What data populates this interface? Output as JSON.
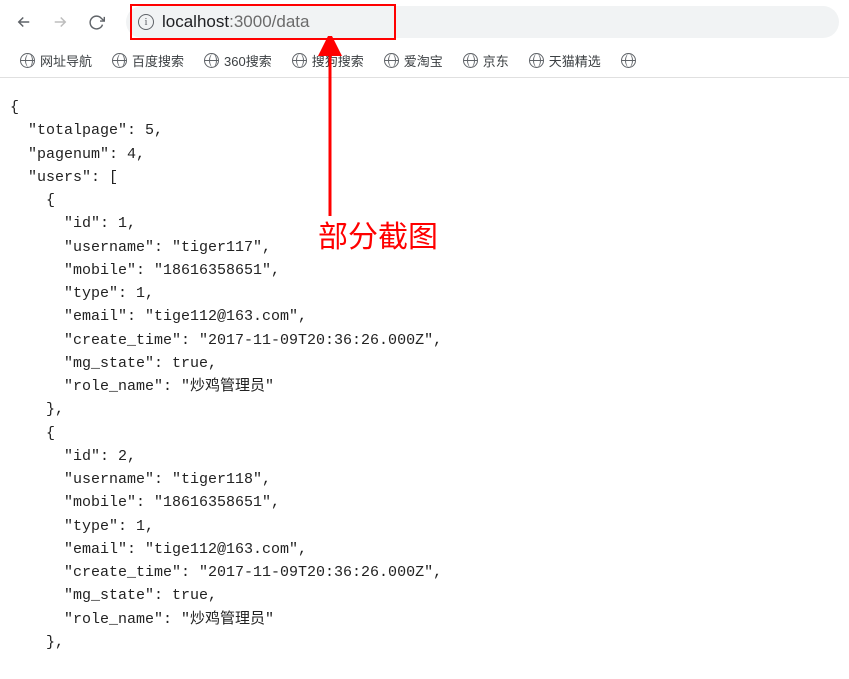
{
  "toolbar": {
    "url_host": "localhost",
    "url_rest": ":3000/data"
  },
  "bookmarks": {
    "items": [
      {
        "label": "网址导航"
      },
      {
        "label": "百度搜索"
      },
      {
        "label": "360搜索"
      },
      {
        "label": "搜狗搜索"
      },
      {
        "label": "爱淘宝"
      },
      {
        "label": "京东"
      },
      {
        "label": "天猫精选"
      }
    ]
  },
  "annotation": {
    "label": "部分截图"
  },
  "json_body": "{\n  \"totalpage\": 5,\n  \"pagenum\": 4,\n  \"users\": [\n    {\n      \"id\": 1,\n      \"username\": \"tiger117\",\n      \"mobile\": \"18616358651\",\n      \"type\": 1,\n      \"email\": \"tige112@163.com\",\n      \"create_time\": \"2017-11-09T20:36:26.000Z\",\n      \"mg_state\": true,\n      \"role_name\": \"炒鸡管理员\"\n    },\n    {\n      \"id\": 2,\n      \"username\": \"tiger118\",\n      \"mobile\": \"18616358651\",\n      \"type\": 1,\n      \"email\": \"tige112@163.com\",\n      \"create_time\": \"2017-11-09T20:36:26.000Z\",\n      \"mg_state\": true,\n      \"role_name\": \"炒鸡管理员\"\n    },"
}
